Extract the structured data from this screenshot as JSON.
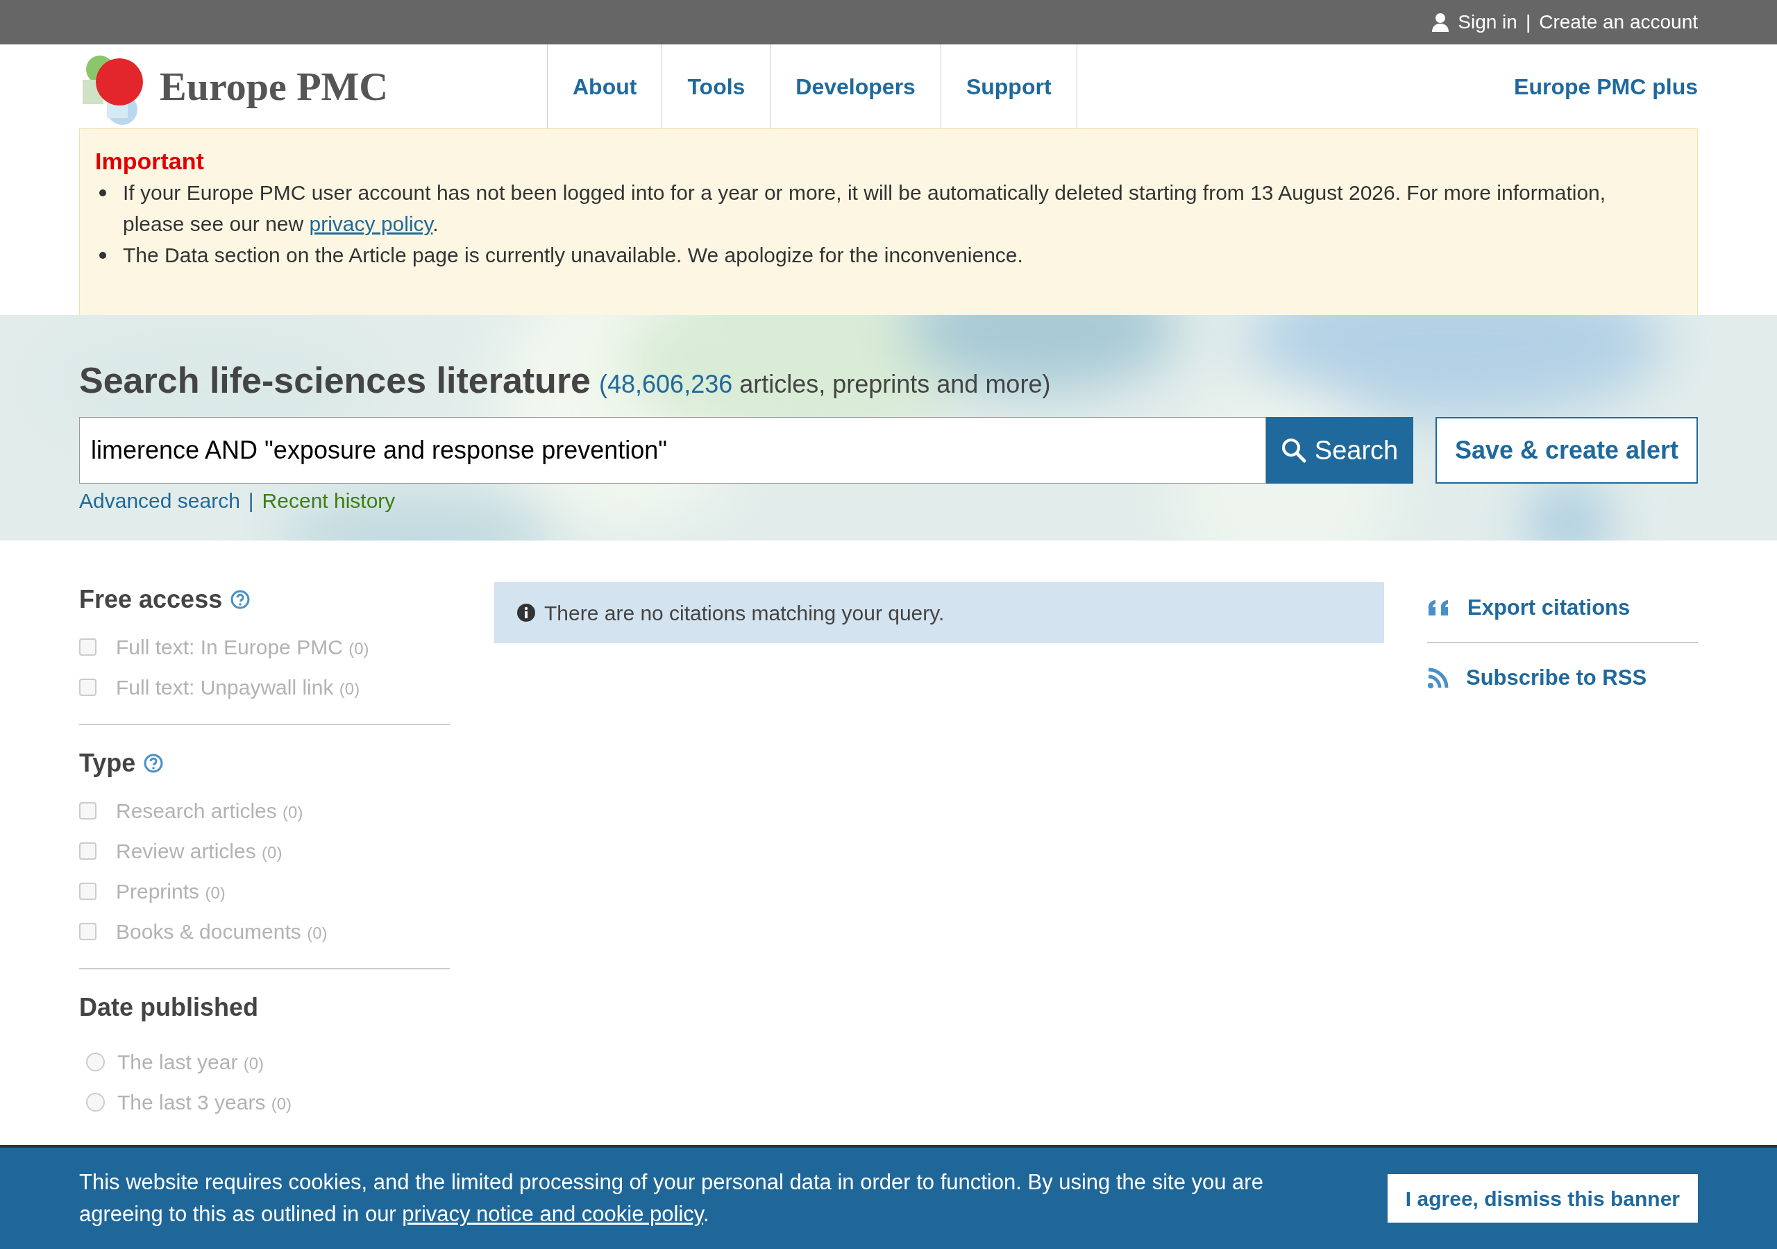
{
  "top_bar": {
    "sign_in": "Sign in",
    "separator": "|",
    "create_account": "Create an account"
  },
  "logo": {
    "text": "Europe PMC"
  },
  "nav": {
    "items": [
      {
        "label": "About"
      },
      {
        "label": "Tools"
      },
      {
        "label": "Developers"
      },
      {
        "label": "Support"
      }
    ],
    "plus": "Europe PMC plus"
  },
  "notice": {
    "title": "Important",
    "items": [
      {
        "text": "If your Europe PMC user account has not been logged into for a year or more, it will be automatically deleted starting from 13 August 2026. For more information,",
        "line2": "please see our new ",
        "link": "privacy policy",
        "after": "."
      },
      {
        "text": "The Data section on the Article page is currently unavailable. We apologize for the inconvenience."
      }
    ]
  },
  "search": {
    "heading": "Search life-sciences literature",
    "count": "(48,606,236",
    "count_rest": "articles, preprints and more)",
    "query": "limerence AND \"exposure and response prevention\"",
    "button": "Search",
    "save_button": "Save & create alert",
    "advanced": "Advanced search",
    "separator": "|",
    "history": "Recent history"
  },
  "filters": [
    {
      "title": "Free access",
      "help": true,
      "kind": "checkbox",
      "items": [
        {
          "label": "Full text: In Europe PMC",
          "count": "(0)",
          "checked": false
        },
        {
          "label": "Full text: Unpaywall link",
          "count": "(0)",
          "checked": false
        }
      ]
    },
    {
      "title": "Type",
      "help": true,
      "kind": "checkbox",
      "items": [
        {
          "label": "Research articles",
          "count": "(0)",
          "checked": false
        },
        {
          "label": "Review articles",
          "count": "(0)",
          "checked": false
        },
        {
          "label": "Preprints",
          "count": "(0)",
          "checked": false
        },
        {
          "label": "Books & documents",
          "count": "(0)",
          "checked": false
        }
      ]
    },
    {
      "title": "Date published",
      "help": false,
      "kind": "radio",
      "items": [
        {
          "label": "The last year",
          "count": "(0)",
          "selected": false
        },
        {
          "label": "The last 3 years",
          "count": "(0)",
          "selected": false
        }
      ]
    }
  ],
  "results": {
    "message": "There are no citations matching your query."
  },
  "side_links": [
    {
      "kind": "quote",
      "label": "Export citations"
    },
    {
      "kind": "rss",
      "label": "Subscribe to RSS"
    }
  ],
  "cookie_banner": {
    "text": "This website requires cookies, and the limited processing of your personal data in order to function. By using the site you are agreeing to this as outlined in our ",
    "link": "privacy notice and cookie policy",
    "after": ".",
    "button": "I agree, dismiss this banner"
  }
}
